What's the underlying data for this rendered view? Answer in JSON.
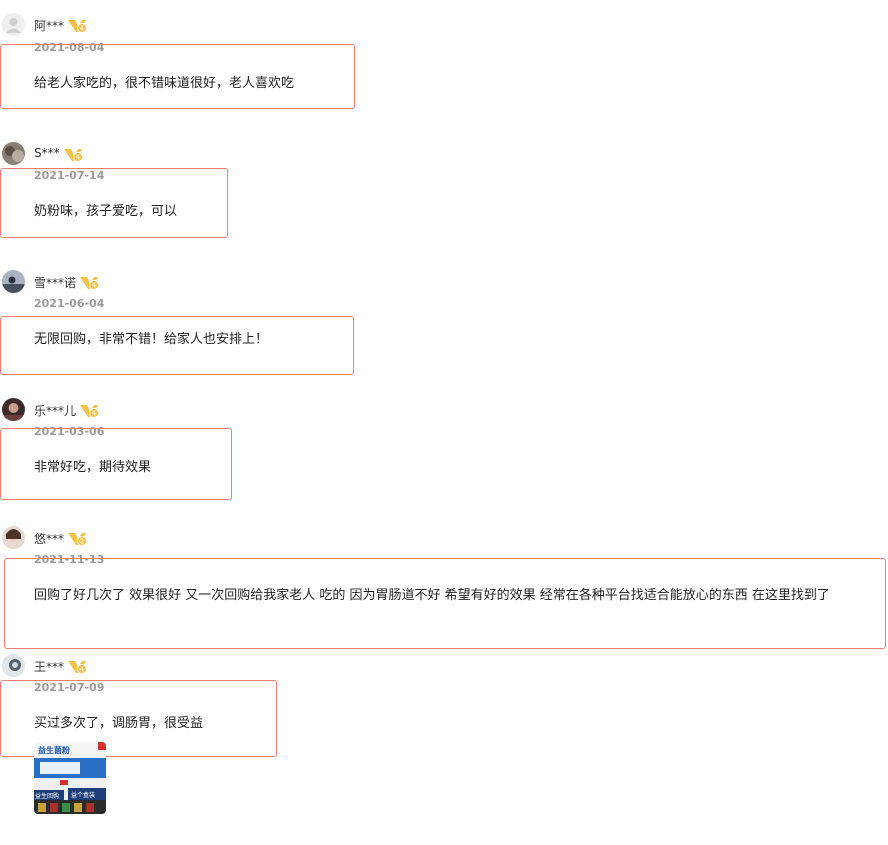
{
  "reviews": [
    {
      "user": "阿***",
      "level": "4",
      "date": "2021-08-04",
      "text": "给老人家吃的，很不错味道很好，老人喜欢吃"
    },
    {
      "user": "S***",
      "level": "4",
      "date": "2021-07-14",
      "text": "奶粉味，孩子爱吃，可以"
    },
    {
      "user": "雪***诺",
      "level": "4",
      "date": "2021-06-04",
      "text": "无限回购，非常不错！给家人也安排上！"
    },
    {
      "user": "乐***儿",
      "level": "4",
      "date": "2021-03-06",
      "text": "非常好吃，期待效果"
    },
    {
      "user": "悠***",
      "level": "2",
      "date": "2021-11-13",
      "text": "回购了好几次了 效果很好 又一次回购给我家老人 吃的 因为胃肠道不好 希望有好的效果 经常在各种平台找适合能放心的东西 在这里找到了"
    },
    {
      "user": "王***",
      "level": "4",
      "date": "2021-07-09",
      "text": "买过多次了，调肠胃，很受益"
    }
  ],
  "photo": {
    "line1": "益生菌粉",
    "line2": "益生回购",
    "line3": "益个盒装"
  },
  "colors": {
    "highlight_border": "#f07e74",
    "badge_gold": "#f5c04a",
    "date_gray": "#9a9a9a"
  }
}
